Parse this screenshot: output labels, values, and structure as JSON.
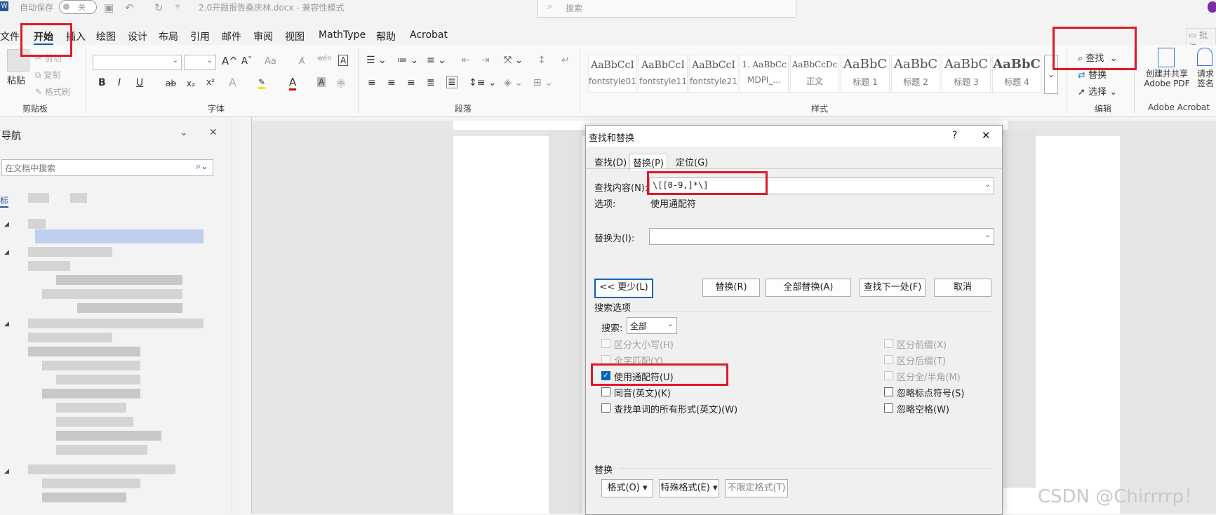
{
  "titlebar": {
    "autosave_label": "自动保存",
    "autosave_state": "关",
    "doc_title": "2.0开题报告桑庆林.docx  -  兼容性模式",
    "search_placeholder": "搜索"
  },
  "menu": {
    "tabs": [
      "文件",
      "开始",
      "插入",
      "绘图",
      "设计",
      "布局",
      "引用",
      "邮件",
      "审阅",
      "视图",
      "MathType",
      "帮助",
      "Acrobat"
    ],
    "active_tab": "开始",
    "comment_label": "批注"
  },
  "ribbon": {
    "clipboard": {
      "paste": "粘贴",
      "cut": "剪切",
      "copy": "复制",
      "format_painter": "格式刷",
      "group_label": "剪贴板"
    },
    "font": {
      "group_label": "字体",
      "grow": "A",
      "shrink": "A",
      "change_case": "Aa",
      "bold": "B",
      "italic": "I",
      "underline": "U",
      "strike": "ab",
      "subscript": "x₂",
      "superscript": "x²"
    },
    "paragraph": {
      "group_label": "段落"
    },
    "styles": {
      "group_label": "样式",
      "tiles": [
        {
          "preview": "AaBbCcI",
          "name": "fontstyle01"
        },
        {
          "preview": "AaBbCcI",
          "name": "fontstyle11"
        },
        {
          "preview": "AaBbCcI",
          "name": "fontstyle21"
        },
        {
          "preview": "1. AaBbCc",
          "name": "MDPI_..."
        },
        {
          "preview": "AaBbCcDc",
          "name": "正文"
        },
        {
          "preview": "AaBbC",
          "name": "标题 1"
        },
        {
          "preview": "AaBbC",
          "name": "标题 2"
        },
        {
          "preview": "AaBbC",
          "name": "标题 3"
        },
        {
          "preview": "AaBbC",
          "name": "标题 4"
        }
      ]
    },
    "editing": {
      "find": "查找",
      "replace": "替换",
      "select": "选择",
      "group_label": "编辑"
    },
    "acrobat": {
      "create_pdf": "创建并共享 Adobe PDF",
      "request_sign": "请求签名",
      "group_label": "Adobe Acrobat"
    }
  },
  "nav": {
    "title": "导航",
    "search_placeholder": "在文档中搜索",
    "tab_label": "标"
  },
  "dialog": {
    "title": "查找和替换",
    "help": "?",
    "close": "✕",
    "tabs": [
      "查找(D)",
      "替换(P)",
      "定位(G)"
    ],
    "find_label": "查找内容(N):",
    "find_value": "\\[[0-9,]*\\]",
    "options_label": "选项:",
    "options_value": "使用通配符",
    "replace_label": "替换为(I):",
    "replace_value": "",
    "buttons": {
      "less": "<< 更少(L)",
      "replace": "替换(R)",
      "replace_all": "全部替换(A)",
      "find_next": "查找下一处(F)",
      "cancel": "取消"
    },
    "search_options_header": "搜索选项",
    "search_label": "搜索:",
    "search_value": "全部",
    "left_options": [
      {
        "label": "区分大小写(H)",
        "checked": false,
        "disabled": true
      },
      {
        "label": "全字匹配(Y)",
        "checked": false,
        "disabled": true
      },
      {
        "label": "使用通配符(U)",
        "checked": true,
        "disabled": false
      },
      {
        "label": "同音(英文)(K)",
        "checked": false,
        "disabled": false
      },
      {
        "label": "查找单词的所有形式(英文)(W)",
        "checked": false,
        "disabled": false
      }
    ],
    "right_options": [
      {
        "label": "区分前缀(X)",
        "checked": false,
        "disabled": true
      },
      {
        "label": "区分后缀(T)",
        "checked": false,
        "disabled": true
      },
      {
        "label": "区分全/半角(M)",
        "checked": false,
        "disabled": true
      },
      {
        "label": "忽略标点符号(S)",
        "checked": false,
        "disabled": false
      },
      {
        "label": "忽略空格(W)",
        "checked": false,
        "disabled": false
      }
    ],
    "replace_section_header": "替换",
    "bottom_buttons": {
      "format": "格式(O) ▾",
      "special": "特殊格式(E) ▾",
      "no_format": "不限定格式(T)"
    }
  },
  "watermark": "CSDN @Chirrrrp！",
  "colors": {
    "accent": "#0067c0",
    "annotation_red": "#e1182a"
  }
}
